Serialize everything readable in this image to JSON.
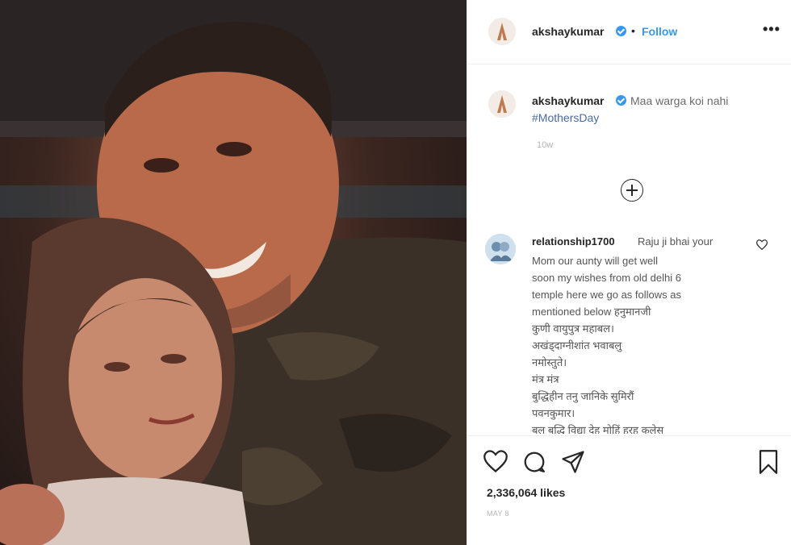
{
  "post": {
    "username": "akshaykumar",
    "follow_label": "Follow",
    "separator": "•",
    "more_label": "•••",
    "caption_text": "Maa warga koi nahi",
    "caption_hashtag": "#MothersDay",
    "caption_time": "10w",
    "likes": "2,336,064 likes",
    "date": "MAY 8"
  },
  "comment": {
    "username": "relationship1700",
    "first_line": "Raju ji bhai your",
    "body": "Mom our aunty will get well\nsoon my wishes from old delhi 6\ntemple here we go as follows as\nmentioned below हनुमानजी\nकुणी वायुपुत्र महाबल।\nअखंड्दाग्नीशांत भवाबलु\nनमोस्तुते।\nमंत्र मंत्र\nबुद्धिहीन तनु जानिके सुमिरौं\nपवनकुमार।\nबल बुद्धि विद्या देहु मोहिं हरहु कलेस"
  },
  "icons": {
    "heart": "heart-icon",
    "comment": "comment-icon",
    "share": "paper-plane-icon",
    "save": "bookmark-icon",
    "add": "plus-circle-icon",
    "verified": "verified-badge-icon"
  },
  "colors": {
    "link_blue": "#3897f0",
    "text": "#262626",
    "muted": "#b5b5b5"
  }
}
